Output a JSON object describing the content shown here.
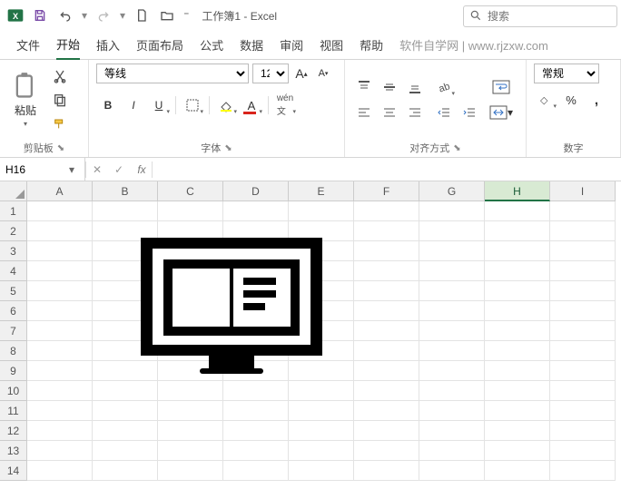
{
  "app": {
    "doc_title": "工作簿1 - Excel"
  },
  "search": {
    "placeholder": "搜索"
  },
  "tabs": {
    "items": [
      "文件",
      "开始",
      "插入",
      "页面布局",
      "公式",
      "数据",
      "审阅",
      "视图",
      "帮助"
    ],
    "extra": "软件自学网 | www.rjzxw.com",
    "active_index": 1
  },
  "ribbon": {
    "clipboard": {
      "paste": "粘贴",
      "label": "剪贴板"
    },
    "font": {
      "name": "等线",
      "size": "12",
      "label": "字体"
    },
    "alignment": {
      "label": "对齐方式"
    },
    "number": {
      "format": "常规",
      "label": "数字"
    }
  },
  "namebox": {
    "value": "H16"
  },
  "grid": {
    "cols": [
      "A",
      "B",
      "C",
      "D",
      "E",
      "F",
      "G",
      "H",
      "I"
    ],
    "row_count": 14,
    "selected_col": "H"
  }
}
